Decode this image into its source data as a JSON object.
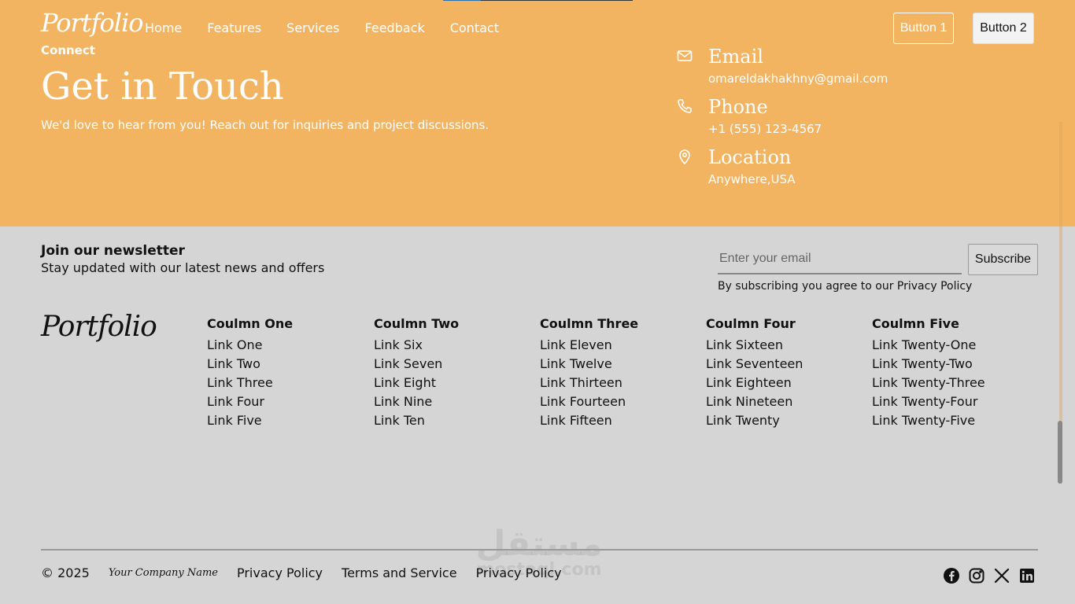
{
  "header": {
    "brand": "Portfolio",
    "nav": [
      "Home",
      "Features",
      "Services",
      "Feedback",
      "Contact"
    ],
    "button1": "Button 1",
    "button2": "Button 2"
  },
  "hero": {
    "eyebrow": "Connect",
    "title": "Get in Touch",
    "subtitle": "We'd love to hear from you! Reach out for inquiries and project discussions."
  },
  "contact": [
    {
      "icon": "mail-icon",
      "label": "Email",
      "value": "omareldakhakhny@gmail.com"
    },
    {
      "icon": "phone-icon",
      "label": "Phone",
      "value": "+1 (555) 123-4567"
    },
    {
      "icon": "location-pin-icon",
      "label": "Location",
      "value": "Anywhere,USA"
    }
  ],
  "newsletter": {
    "title": "Join our newsletter",
    "subtitle": "Stay updated with our latest news and offers",
    "placeholder": "Enter your email",
    "button": "Subscribe",
    "note": "By subscribing you agree to our Privacy Policy"
  },
  "footer": {
    "logo": "Portfolio",
    "columns": [
      {
        "title": "Coulmn One",
        "links": [
          "Link One",
          "Link Two",
          "Link Three",
          "Link Four",
          "Link Five"
        ]
      },
      {
        "title": "Coulmn Two",
        "links": [
          "Link Six",
          "Link Seven",
          "Link Eight",
          "Link Nine",
          "Link Ten"
        ]
      },
      {
        "title": "Coulmn Three",
        "links": [
          "Link Eleven",
          "Link Twelve",
          "Link Thirteen",
          "Link Fourteen",
          "Link Fifteen"
        ]
      },
      {
        "title": "Coulmn Four",
        "links": [
          "Link Sixteen",
          "Link Seventeen",
          "Link Eighteen",
          "Link Nineteen",
          "Link Twenty"
        ]
      },
      {
        "title": "Coulmn Five",
        "links": [
          "Link Twenty-One",
          "Link Twenty-Two",
          "Link Twenty-Three",
          "Link Twenty-Four",
          "Link Twenty-Five"
        ]
      }
    ],
    "copyright": "© 2025",
    "company_signature": "Your Company Name",
    "links": [
      "Privacy Policy",
      "Terms and Service",
      "Privacy Policy"
    ],
    "social": [
      "facebook-icon",
      "instagram-icon",
      "x-icon",
      "linkedin-icon"
    ]
  },
  "watermark": {
    "arabic": "مستقل",
    "latin": "mostaql.com"
  },
  "colors": {
    "accent": "#f3b462",
    "footer_bg": "#d5d5d5"
  }
}
